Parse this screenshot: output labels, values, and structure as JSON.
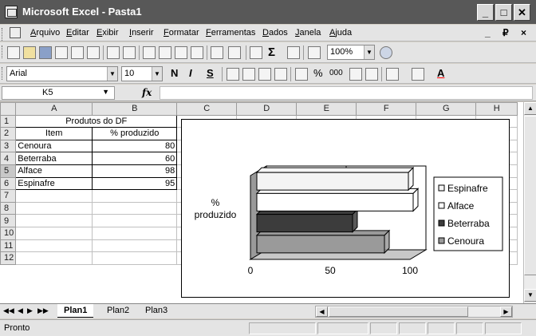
{
  "window": {
    "title": "Microsoft Excel - Pasta1",
    "app_icon": "excel-icon"
  },
  "menu": {
    "items": [
      "Arquivo",
      "Editar",
      "Exibir",
      "Inserir",
      "Formatar",
      "Ferramentas",
      "Dados",
      "Janela",
      "Ajuda"
    ],
    "doc_controls": "_ ₽ ×"
  },
  "toolbar": {
    "zoom": "100%",
    "font": "Arial",
    "font_size": "10",
    "bold": "N",
    "italic": "I",
    "underline": "S",
    "percent": "%",
    "thousands": "000",
    "inc_decimal": ",00→,0",
    "fill_color": "#ffff00",
    "font_color": "#ff0000",
    "font_color_label": "A"
  },
  "formula_bar": {
    "name_box": "K5",
    "fx": "fx",
    "formula": ""
  },
  "grid": {
    "columns": [
      "A",
      "B",
      "C",
      "D",
      "E",
      "F",
      "G",
      "H"
    ],
    "rows": [
      {
        "n": "1",
        "a": "Produtos do DF",
        "b": ""
      },
      {
        "n": "2",
        "a": "Item",
        "b": "% produzido"
      },
      {
        "n": "3",
        "a": "Cenoura",
        "b": "80"
      },
      {
        "n": "4",
        "a": "Beterraba",
        "b": "60"
      },
      {
        "n": "5",
        "a": "Alface",
        "b": "98"
      },
      {
        "n": "6",
        "a": "Espinafre",
        "b": "95"
      },
      {
        "n": "7",
        "a": "",
        "b": ""
      },
      {
        "n": "8",
        "a": "",
        "b": ""
      },
      {
        "n": "9",
        "a": "",
        "b": ""
      },
      {
        "n": "10",
        "a": "",
        "b": ""
      },
      {
        "n": "11",
        "a": "",
        "b": ""
      },
      {
        "n": "12",
        "a": "",
        "b": ""
      }
    ]
  },
  "chart_data": {
    "type": "bar",
    "orientation": "horizontal",
    "3d": true,
    "categories": [
      "Cenoura",
      "Beterraba",
      "Alface",
      "Espinafre"
    ],
    "values": [
      80,
      60,
      98,
      95
    ],
    "colors": [
      "#9a9a9a",
      "#3c3c3c",
      "#ffffff",
      "#f4f4f4"
    ],
    "ylabel": "% produzido",
    "xlim": [
      0,
      100
    ],
    "xticks": [
      "0",
      "50",
      "100"
    ],
    "legend": [
      "Espinafre",
      "Alface",
      "Beterraba",
      "Cenoura"
    ],
    "legend_colors": [
      "#f4f4f4",
      "#ffffff",
      "#3c3c3c",
      "#9a9a9a"
    ],
    "legend_position": "right"
  },
  "sheets": {
    "tabs": [
      "Plan1",
      "Plan2",
      "Plan3"
    ],
    "active": "Plan1"
  },
  "status": {
    "text": "Pronto"
  }
}
